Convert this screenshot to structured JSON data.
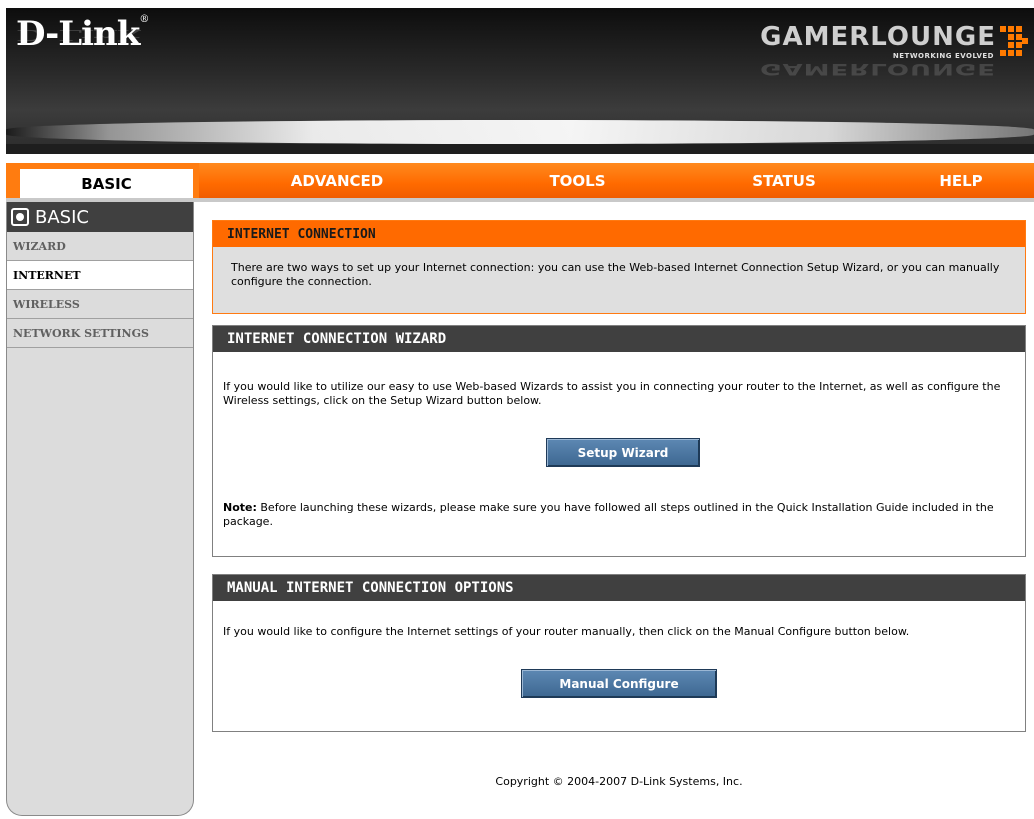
{
  "header": {
    "logo": "D-Link",
    "brand": "GAMERLOUNGE",
    "brand_tagline": "NETWORKING EVOLVED"
  },
  "nav": {
    "tabs": [
      {
        "label": "BASIC",
        "active": true
      },
      {
        "label": "ADVANCED",
        "active": false
      },
      {
        "label": "TOOLS",
        "active": false
      },
      {
        "label": "STATUS",
        "active": false
      },
      {
        "label": "HELP",
        "active": false
      }
    ]
  },
  "sidebar": {
    "title": "BASIC",
    "items": [
      {
        "label": "WIZARD",
        "active": false
      },
      {
        "label": "INTERNET",
        "active": true
      },
      {
        "label": "WIRELESS",
        "active": false
      },
      {
        "label": "NETWORK SETTINGS",
        "active": false
      }
    ]
  },
  "intro": {
    "title": "INTERNET CONNECTION",
    "text": "There are two ways to set up your Internet connection: you can use the Web-based Internet Connection Setup Wizard, or you can manually configure the connection."
  },
  "wizard": {
    "title": "INTERNET CONNECTION WIZARD",
    "text": "If you would like to utilize our easy to use Web-based Wizards to assist you in connecting your router to the Internet, as well as configure the Wireless settings, click on the Setup Wizard button below.",
    "button": "Setup Wizard",
    "note_label": "Note:",
    "note_text": " Before launching these wizards, please make sure you have followed all steps outlined in the Quick Installation Guide included in the package."
  },
  "manual": {
    "title": "MANUAL INTERNET CONNECTION OPTIONS",
    "text": "If you would like to configure the Internet settings of your router manually, then click on the Manual Configure button below.",
    "button": "Manual Configure"
  },
  "footer": {
    "copyright": "Copyright © 2004-2007 D-Link Systems, Inc."
  },
  "colors": {
    "accent_orange": "#ff6a00",
    "header_dark": "#404040",
    "button_blue": "#4a74a0"
  }
}
